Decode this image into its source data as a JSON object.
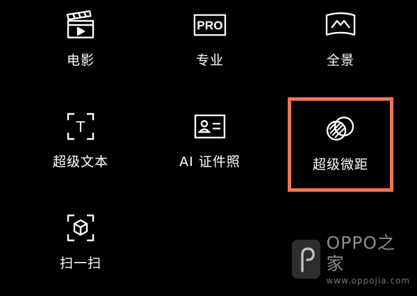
{
  "modes": [
    {
      "label": "电影",
      "icon": "clapperboard-icon"
    },
    {
      "label": "专业",
      "icon": "pro-badge-icon",
      "badge": "PRO"
    },
    {
      "label": "全景",
      "icon": "panorama-icon"
    },
    {
      "label": "超级文本",
      "icon": "text-scan-icon",
      "glyph": "T"
    },
    {
      "label": "AI 证件照",
      "icon": "id-card-icon"
    },
    {
      "label": "超级微距",
      "icon": "macro-icon"
    },
    {
      "label": "扫一扫",
      "icon": "scan-cube-icon"
    }
  ],
  "highlight": {
    "target": "超级微距",
    "color": "#f07651"
  },
  "watermark": {
    "brand": "OPPO之家",
    "url": "www.oppojia.com"
  },
  "colors": {
    "background": "#000000",
    "foreground": "#ffffff",
    "highlight": "#f07651"
  }
}
